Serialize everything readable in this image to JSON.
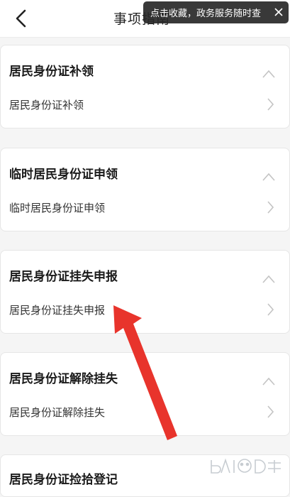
{
  "header": {
    "title": "事项指南",
    "back_icon": "chevron-left-icon"
  },
  "toast": {
    "text": "点击收藏，政务服务随时查",
    "close_icon": "close-icon"
  },
  "cards": [
    {
      "title": "居民身份证补领",
      "item": "居民身份证补领"
    },
    {
      "title": "临时居民身份证申领",
      "item": "临时居民身份证申领"
    },
    {
      "title": "居民身份证挂失申报",
      "item": "居民身份证挂失申报"
    },
    {
      "title": "居民身份证解除挂失",
      "item": "居民身份证解除挂失"
    },
    {
      "title": "居民身份证捡拾登记",
      "item": ""
    }
  ],
  "colors": {
    "annotation_arrow": "#e8342c",
    "background": "#f5f5f5",
    "card": "#ffffff"
  }
}
